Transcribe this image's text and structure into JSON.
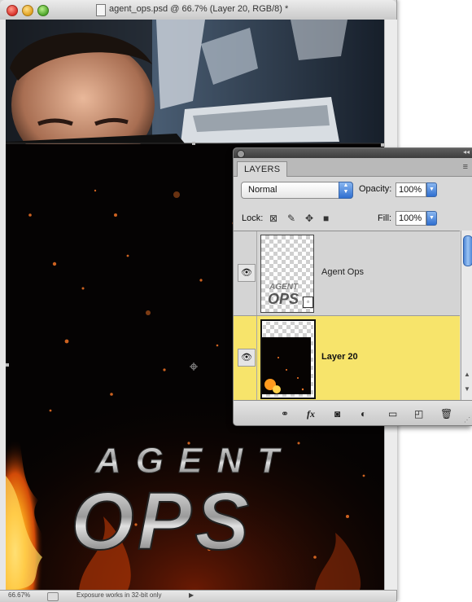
{
  "window": {
    "title": "agent_ops.psd @ 66.7% (Layer 20, RGB/8) *"
  },
  "canvas_art": {
    "headline_top": "AGENT",
    "headline_bottom": "OPS"
  },
  "statusbar": {
    "zoom": "66.67%",
    "message": "Exposure works in 32-bit only",
    "arrow": "▶"
  },
  "layers_panel": {
    "tab_label": "LAYERS",
    "menu_icon": "≡",
    "collapse_icon": "◂◂",
    "blend_mode": "Normal",
    "opacity_label": "Opacity:",
    "opacity_value": "100%",
    "lock_label": "Lock:",
    "fill_label": "Fill:",
    "fill_value": "100%",
    "lock_icons": [
      "checker-lock-icon",
      "brush-lock-icon",
      "move-lock-icon",
      "padlock-icon"
    ],
    "layers": [
      {
        "name": "Agent Ops",
        "visible": true,
        "selected": false,
        "type": "smart-object"
      },
      {
        "name": "Layer 20",
        "visible": true,
        "selected": true,
        "type": "pixel"
      }
    ],
    "footer_icons": [
      "link-icon",
      "fx-icon",
      "mask-icon",
      "adjustment-icon",
      "folder-icon",
      "new-layer-icon",
      "trash-icon"
    ],
    "footer_fx_label": "fx"
  },
  "colors": {
    "selected_row": "#f7e46b",
    "accent_blue": "#2f6fd0"
  }
}
